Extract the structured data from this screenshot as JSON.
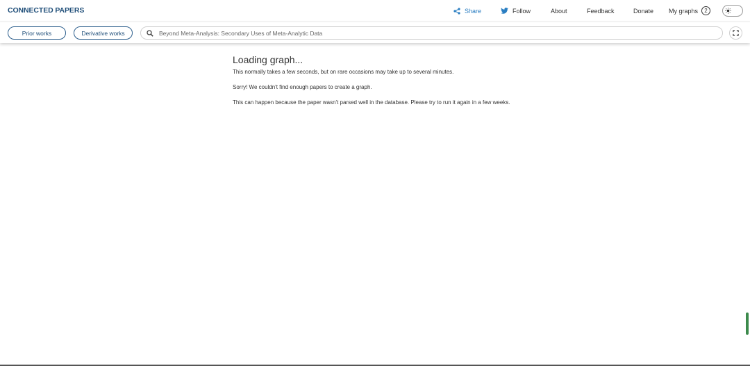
{
  "header": {
    "logo": "CONNECTED PAPERS",
    "nav": {
      "share": "Share",
      "follow": "Follow",
      "about": "About",
      "feedback": "Feedback",
      "donate": "Donate",
      "my_graphs": "My graphs",
      "my_graphs_count": "2"
    },
    "accent_color": "#2a7ec2"
  },
  "toolbar": {
    "prior_works": "Prior works",
    "derivative_works": "Derivative works",
    "search_value": "Beyond Meta-Analysis: Secondary Uses of Meta-Analytic Data"
  },
  "main": {
    "heading": "Loading graph...",
    "line1": "This normally takes a few seconds, but on rare occasions may take up to several minutes.",
    "line2": "Sorry! We couldn't find enough papers to create a graph.",
    "line3": "This can happen because the paper wasn't parsed well in the database. Please try to run it again in a few weeks."
  }
}
